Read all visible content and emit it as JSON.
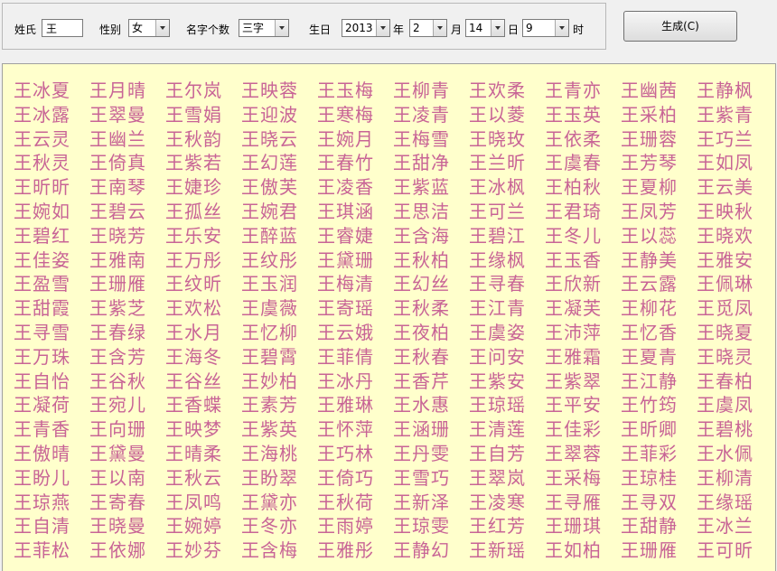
{
  "form": {
    "surname_label": "姓氏",
    "surname_value": "王",
    "gender_label": "性别",
    "gender_value": "女",
    "name_length_label": "名字个数",
    "name_length_value": "三字",
    "birthday_label": "生日",
    "year_value": "2013",
    "year_unit": "年",
    "month_value": "2",
    "month_unit": "月",
    "day_value": "14",
    "day_unit": "日",
    "hour_value": "9",
    "hour_unit": "时",
    "generate_label": "生成(C)"
  },
  "names": [
    "王冰夏",
    "王月晴",
    "王尔岚",
    "王映蓉",
    "王玉梅",
    "王柳青",
    "王欢柔",
    "王青亦",
    "王幽茜",
    "王静枫",
    "王冰露",
    "王翠曼",
    "王雪娟",
    "王迎波",
    "王寒梅",
    "王凌青",
    "王以菱",
    "王玉英",
    "王采柏",
    "王紫青",
    "王云灵",
    "王幽兰",
    "王秋韵",
    "王晓云",
    "王婉月",
    "王梅雪",
    "王晓玫",
    "王依柔",
    "王珊蓉",
    "王巧兰",
    "王秋灵",
    "王倚真",
    "王紫若",
    "王幻莲",
    "王春竹",
    "王甜净",
    "王兰昕",
    "王虞春",
    "王芳琴",
    "王如凤",
    "王昕昕",
    "王南琴",
    "王婕珍",
    "王傲芙",
    "王凌香",
    "王紫蓝",
    "王冰枫",
    "王柏秋",
    "王夏柳",
    "王云美",
    "王婉如",
    "王碧云",
    "王孤丝",
    "王婉君",
    "王琪涵",
    "王思洁",
    "王可兰",
    "王君琦",
    "王凤芳",
    "王映秋",
    "王碧红",
    "王晓芳",
    "王乐安",
    "王醉蓝",
    "王睿婕",
    "王含海",
    "王碧江",
    "王冬儿",
    "王以蕊",
    "王晓欢",
    "王佳姿",
    "王雅南",
    "王万彤",
    "王纹彤",
    "王黛珊",
    "王秋柏",
    "王缘枫",
    "王玉香",
    "王静美",
    "王雅安",
    "王盈雪",
    "王珊雁",
    "王纹昕",
    "王玉润",
    "王梅清",
    "王幻丝",
    "王寻春",
    "王欣新",
    "王云露",
    "王佩琳",
    "王甜霞",
    "王紫芝",
    "王欢松",
    "王虞薇",
    "王寄瑶",
    "王秋柔",
    "王江青",
    "王凝芙",
    "王柳花",
    "王觅凤",
    "王寻雪",
    "王春绿",
    "王水月",
    "王忆柳",
    "王云娥",
    "王夜柏",
    "王虞姿",
    "王沛萍",
    "王忆香",
    "王晓夏",
    "王万珠",
    "王含芳",
    "王海冬",
    "王碧霄",
    "王菲倩",
    "王秋春",
    "王问安",
    "王雅霜",
    "王夏青",
    "王晓灵",
    "王自怡",
    "王谷秋",
    "王谷丝",
    "王妙柏",
    "王冰丹",
    "王香芹",
    "王紫安",
    "王紫翠",
    "王江静",
    "王春柏",
    "王凝荷",
    "王宛儿",
    "王香蝶",
    "王素芳",
    "王雅琳",
    "王水惠",
    "王琼瑶",
    "王平安",
    "王竹筠",
    "王虞凤",
    "王青香",
    "王向珊",
    "王映梦",
    "王紫英",
    "王怀萍",
    "王涵珊",
    "王清莲",
    "王佳彩",
    "王昕卿",
    "王碧桃",
    "王傲晴",
    "王黛曼",
    "王晴柔",
    "王海桃",
    "王巧林",
    "王丹雯",
    "王自芳",
    "王翠蓉",
    "王菲彩",
    "王水佩",
    "王盼儿",
    "王以南",
    "王秋云",
    "王盼翠",
    "王倚巧",
    "王雪巧",
    "王翠岚",
    "王采梅",
    "王琼桂",
    "王柳清",
    "王琼燕",
    "王寄春",
    "王凤鸣",
    "王黛亦",
    "王秋荷",
    "王新泽",
    "王凌寒",
    "王寻雁",
    "王寻双",
    "王缘瑶",
    "王自清",
    "王晓曼",
    "王婉婷",
    "王冬亦",
    "王雨婷",
    "王琼雯",
    "王红芳",
    "王珊琪",
    "王甜静",
    "王冰兰",
    "王菲松",
    "王依娜",
    "王妙芬",
    "王含梅",
    "王雅彤",
    "王静幻",
    "王新瑶",
    "王如柏",
    "王珊雁",
    "王可昕"
  ],
  "colors": {
    "name_text": "#c86496",
    "panel_background": "#ffffcc"
  }
}
